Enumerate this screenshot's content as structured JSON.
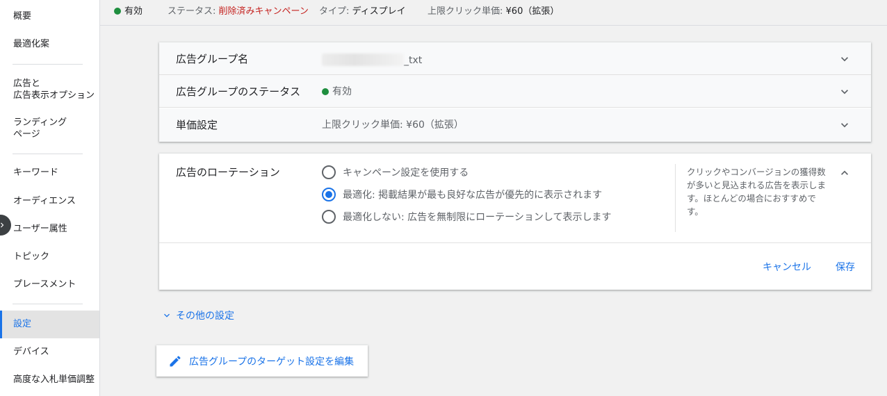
{
  "sidebar": {
    "items": [
      {
        "label": "概要"
      },
      {
        "label": "最適化案"
      },
      {
        "label": "広告と\n広告表示オプション"
      },
      {
        "label": "ランディング\nページ"
      },
      {
        "label": "キーワード"
      },
      {
        "label": "オーディエンス"
      },
      {
        "label": "ユーザー属性"
      },
      {
        "label": "トピック"
      },
      {
        "label": "プレースメント"
      },
      {
        "label": "設定"
      },
      {
        "label": "デバイス"
      },
      {
        "label": "高度な入札単価調整"
      }
    ],
    "active_item": "設定",
    "toggle_icon": "chevron-right-icon"
  },
  "topbar": {
    "status": "有効",
    "status_color": "#1e8e3e",
    "campaign_status_label": "ステータス:",
    "campaign_status_value": "削除済みキャンペーン",
    "type_label": "タイプ:",
    "type_value": "ディスプレイ",
    "max_cpc_label": "上限クリック単価:",
    "max_cpc_value": "¥60（拡張）"
  },
  "settings": {
    "ad_group_name": {
      "label": "広告グループ名",
      "value_suffix": "_txt"
    },
    "ad_group_status": {
      "label": "広告グループのステータス",
      "value": "有効"
    },
    "bidding": {
      "label": "単価設定",
      "value": "上限クリック単価: ¥60（拡張）"
    }
  },
  "rotation": {
    "label": "広告のローテーション",
    "options": [
      {
        "text": "キャンペーン設定を使用する",
        "selected": false
      },
      {
        "text": "最適化: 掲載結果が最も良好な広告が優先的に表示されます",
        "selected": true
      },
      {
        "text": "最適化しない: 広告を無制限にローテーションして表示します",
        "selected": false
      }
    ],
    "help_text": "クリックやコンバージョンの獲得数が多いと見込まれる広告を表示します。ほとんどの場合におすすめです。",
    "cancel_label": "キャンセル",
    "save_label": "保存"
  },
  "other_settings_label": "その他の設定",
  "edit_targeting_label": "広告グループのターゲット設定を編集",
  "colors": {
    "accent": "#1a73e8",
    "danger": "#c5221f",
    "active_green": "#1e8e3e"
  }
}
